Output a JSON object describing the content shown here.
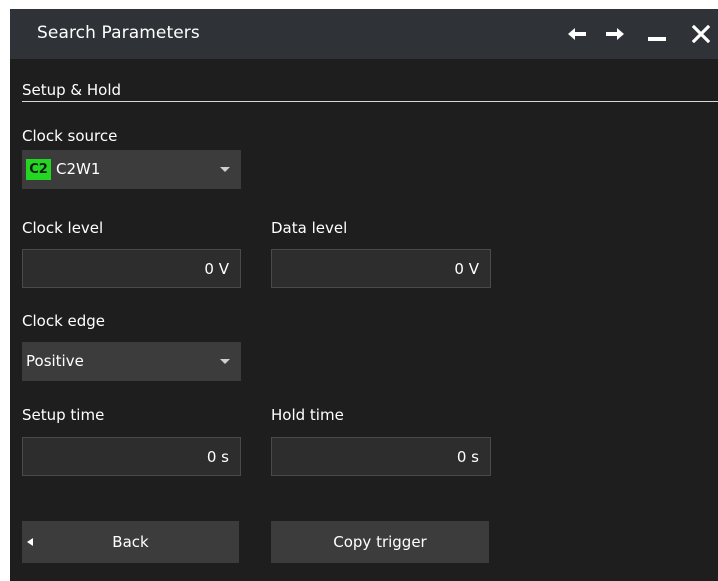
{
  "dialog": {
    "title": "Search Parameters",
    "buttons": {
      "back_arrow": "arrow-left-icon",
      "forward_arrow": "arrow-right-icon",
      "minimize": "minimize-icon",
      "close": "close-icon"
    }
  },
  "section": {
    "label": "Setup & Hold"
  },
  "clock_source": {
    "label": "Clock source",
    "badge": "C2",
    "badge_color": "#22d622",
    "value": "C2W1"
  },
  "clock_level": {
    "label": "Clock level",
    "value": "0 V"
  },
  "data_level": {
    "label": "Data level",
    "value": "0 V"
  },
  "clock_edge": {
    "label": "Clock edge",
    "value": "Positive"
  },
  "setup_time": {
    "label": "Setup time",
    "value": "0 s"
  },
  "hold_time": {
    "label": "Hold time",
    "value": "0 s"
  },
  "footer": {
    "back_label": "Back",
    "copy_trigger_label": "Copy trigger"
  }
}
